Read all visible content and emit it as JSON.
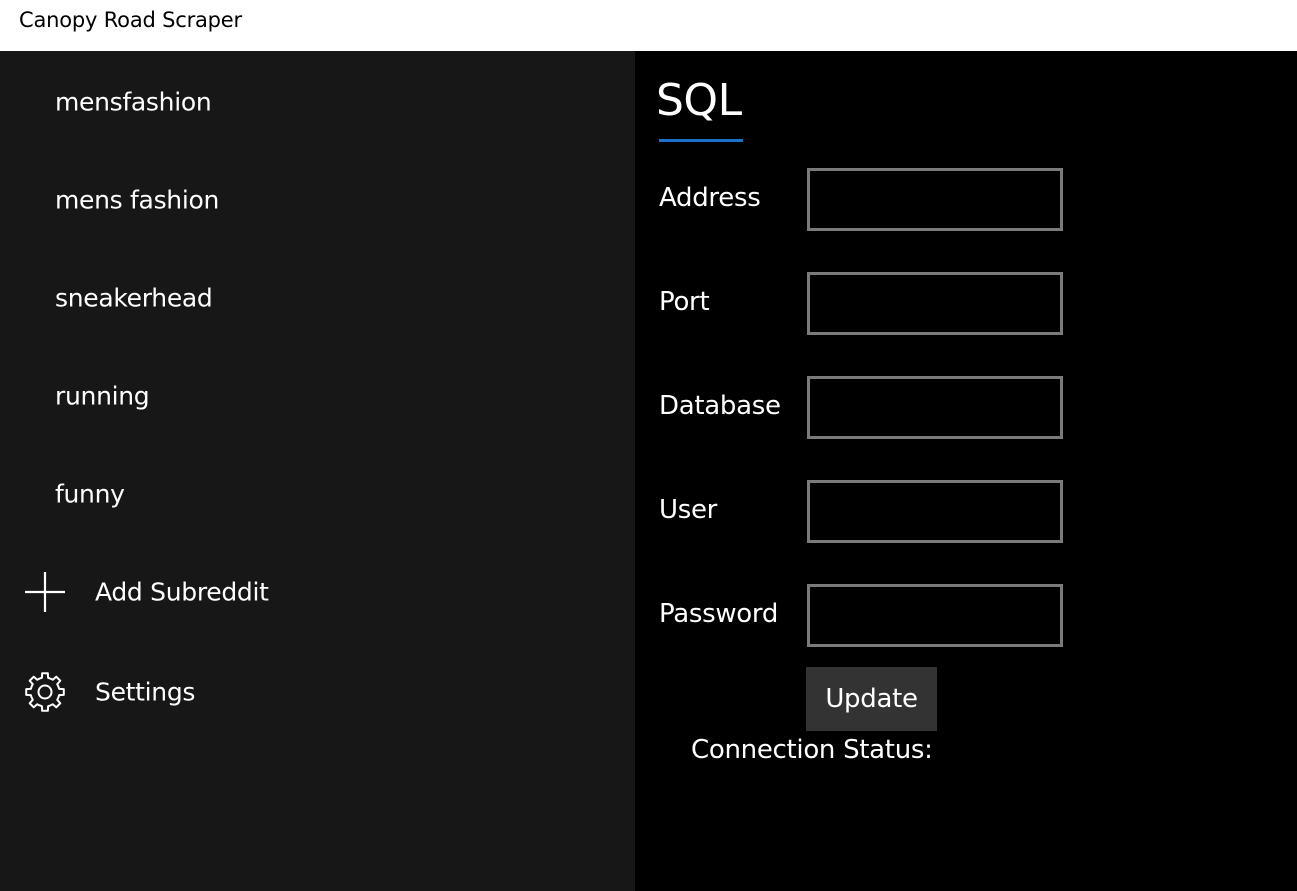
{
  "window": {
    "title": "Canopy Road Scraper"
  },
  "sidebar": {
    "items": [
      {
        "label": "mensfashion"
      },
      {
        "label": "mens fashion"
      },
      {
        "label": "sneakerhead"
      },
      {
        "label": "running"
      },
      {
        "label": "funny"
      }
    ],
    "add": {
      "label": "Add Subreddit",
      "icon": "plus-icon"
    },
    "settings": {
      "label": "Settings",
      "icon": "gear-icon"
    }
  },
  "main": {
    "header": "SQL",
    "accent_color": "#1a73c9",
    "fields": {
      "address": {
        "label": "Address",
        "value": ""
      },
      "port": {
        "label": "Port",
        "value": ""
      },
      "database": {
        "label": "Database",
        "value": ""
      },
      "user": {
        "label": "User",
        "value": ""
      },
      "password": {
        "label": "Password",
        "value": ""
      }
    },
    "update_label": "Update",
    "status_label": "Connection Status:"
  }
}
